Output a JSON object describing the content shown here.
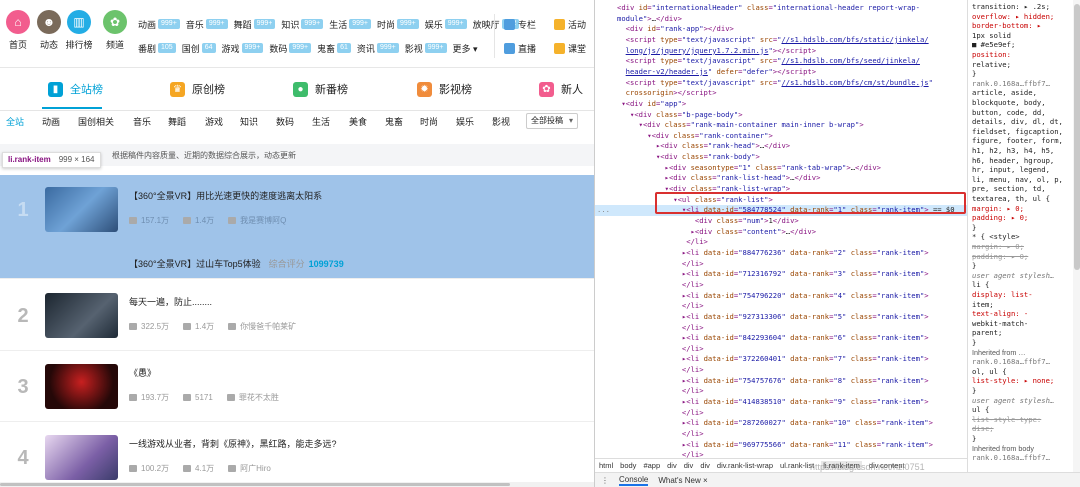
{
  "topnav": {
    "icons": [
      {
        "label": "首页",
        "color": "#f25d8e",
        "glyph": "⌂"
      },
      {
        "label": "动态",
        "color": "#7a6a5a",
        "glyph": "☻"
      },
      {
        "label": "排行榜",
        "color": "#23ade5",
        "glyph": "▥"
      },
      {
        "label": "频道",
        "color": "#6cc36c",
        "glyph": "✿"
      }
    ],
    "categories_row1": [
      {
        "label": "动画",
        "badge": "999+"
      },
      {
        "label": "音乐",
        "badge": "999+"
      },
      {
        "label": "舞蹈",
        "badge": "999+"
      },
      {
        "label": "知识",
        "badge": "999+"
      },
      {
        "label": "生活",
        "badge": "999+"
      },
      {
        "label": "时尚",
        "badge": "999+"
      },
      {
        "label": "娱乐",
        "badge": "999+"
      },
      {
        "label": "放映厅",
        "badge": "122"
      }
    ],
    "categories_row2": [
      {
        "label": "番剧",
        "badge": "105"
      },
      {
        "label": "国创",
        "badge": "64"
      },
      {
        "label": "游戏",
        "badge": "999+"
      },
      {
        "label": "数码",
        "badge": "999+"
      },
      {
        "label": "鬼畜",
        "badge": "61"
      },
      {
        "label": "资讯",
        "badge": "999+"
      },
      {
        "label": "影视",
        "badge": "999+"
      },
      {
        "label": "更多 ▾",
        "badge": ""
      }
    ],
    "right_links": [
      {
        "label": "专栏",
        "color": "#4f9dde"
      },
      {
        "label": "活动",
        "color": "#f5b22b"
      },
      {
        "label": "直播",
        "color": "#4f9dde"
      },
      {
        "label": "课堂",
        "color": "#f5b22b"
      }
    ]
  },
  "tabs": [
    {
      "label": "全站榜",
      "color": "#00a1d6",
      "glyph": "▮"
    },
    {
      "label": "原创榜",
      "color": "#f5a623",
      "glyph": "♛"
    },
    {
      "label": "新番榜",
      "color": "#3ebc6b",
      "glyph": "●"
    },
    {
      "label": "影视榜",
      "color": "#f08c3c",
      "glyph": "✹"
    },
    {
      "label": "新人",
      "color": "#f25d8e",
      "glyph": "✿"
    }
  ],
  "subnav": {
    "items": [
      "全站",
      "动画",
      "国创相关",
      "音乐",
      "舞蹈",
      "游戏",
      "知识",
      "数码",
      "生活",
      "美食",
      "鬼畜",
      "时尚",
      "娱乐",
      "影视"
    ],
    "select": "全部投稿"
  },
  "notice": "根据稿件内容质量、近期的数据综合展示，动态更新",
  "tooltip": {
    "tag": "li.rank-item",
    "size": "999 × 164"
  },
  "items": [
    {
      "rank": "1",
      "title": "【360°全景VR】用比光速更快的速度逃离太阳系",
      "plays": "157.1万",
      "comments": "1.4万",
      "author": "我是赛博阿Q",
      "sub_title": "【360°全景VR】过山车Top5体验",
      "score_label": "综合评分",
      "score": "1099739"
    },
    {
      "rank": "2",
      "title": "每天一遍，防止........",
      "plays": "322.5万",
      "comments": "1.4万",
      "author": "你慢爸千帕莱矿"
    },
    {
      "rank": "3",
      "title": "《愚》",
      "plays": "193.7万",
      "comments": "5171",
      "author": "罪花不太胜"
    },
    {
      "rank": "4",
      "title": "一线游戏从业者，背刺《原神》，黑红路，能走多远?",
      "plays": "100.2万",
      "comments": "4.1万",
      "author": "阿广Hiro"
    }
  ],
  "devtools": {
    "elements": [
      {
        "dots": "",
        "html": "<span class='t'>&lt;div</span> <span class='a'>id</span>=<span class='v'>\"internationalHeader\"</span> <span class='a'>class</span>=<span class='v'>\"international-header report-wrap-</span>"
      },
      {
        "dots": "",
        "html": "<span class='v'>module\"</span><span class='t'>&gt;</span><span class='tx'>…</span><span class='t'>&lt;/div&gt;</span>"
      },
      {
        "dots": "",
        "html": "&nbsp;&nbsp;<span class='t'>&lt;div</span> <span class='a'>id</span>=<span class='v'>\"rank-app\"</span><span class='t'>&gt;&lt;/div&gt;</span>"
      },
      {
        "dots": "",
        "html": "&nbsp;&nbsp;<span class='t'>&lt;script</span> <span class='a'>type</span>=<span class='v'>\"text/javascript\"</span> <span class='a'>src</span>=<span class='v'>\"</span><span class='u'>//s1.hdslb.com/bfs/static/jinkela/</span>"
      },
      {
        "dots": "",
        "html": "&nbsp;&nbsp;<span class='u'>long/js/jquery/jquery1.7.2.min.js</span><span class='v'>\"</span><span class='t'>&gt;&lt;/script&gt;</span>"
      },
      {
        "dots": "",
        "html": "&nbsp;&nbsp;<span class='t'>&lt;script</span> <span class='a'>type</span>=<span class='v'>\"text/javascript\"</span> <span class='a'>src</span>=<span class='v'>\"</span><span class='u'>//s1.hdslb.com/bfs/seed/jinkela/</span>"
      },
      {
        "dots": "",
        "html": "&nbsp;&nbsp;<span class='u'>header-v2/header.js</span><span class='v'>\"</span> <span class='a'>defer</span>=<span class='v'>\"defer\"</span><span class='t'>&gt;&lt;/script&gt;</span>"
      },
      {
        "dots": "",
        "html": "&nbsp;&nbsp;<span class='t'>&lt;script</span> <span class='a'>type</span>=<span class='v'>\"text/javascript\"</span> <span class='a'>src</span>=<span class='v'>\"</span><span class='u'>//s1.hdslb.com/bfs/cm/st/bundle.js</span><span class='v'>\"</span>"
      },
      {
        "dots": "",
        "html": "&nbsp;&nbsp;<span class='a'>crossorigin</span><span class='t'>&gt;&lt;/script&gt;</span>"
      },
      {
        "dots": "",
        "html": "&nbsp;▾<span class='t'>&lt;div</span> <span class='a'>id</span>=<span class='v'>\"app\"</span><span class='t'>&gt;</span>"
      },
      {
        "dots": "",
        "html": "&nbsp;&nbsp;&nbsp;▾<span class='t'>&lt;div</span> <span class='a'>class</span>=<span class='v'>\"b-page-body\"</span><span class='t'>&gt;</span>"
      },
      {
        "dots": "",
        "html": "&nbsp;&nbsp;&nbsp;&nbsp;&nbsp;▾<span class='t'>&lt;div</span> <span class='a'>class</span>=<span class='v'>\"rank-main-container main-inner b-wrap\"</span><span class='t'>&gt;</span>"
      },
      {
        "dots": "",
        "html": "&nbsp;&nbsp;&nbsp;&nbsp;&nbsp;&nbsp;&nbsp;▾<span class='t'>&lt;div</span> <span class='a'>class</span>=<span class='v'>\"rank-container\"</span><span class='t'>&gt;</span>"
      },
      {
        "dots": "",
        "html": "&nbsp;&nbsp;&nbsp;&nbsp;&nbsp;&nbsp;&nbsp;&nbsp;&nbsp;▸<span class='t'>&lt;div</span> <span class='a'>class</span>=<span class='v'>\"rank-head\"</span><span class='t'>&gt;</span><span class='tx'>…</span><span class='t'>&lt;/div&gt;</span>"
      },
      {
        "dots": "",
        "html": "&nbsp;&nbsp;&nbsp;&nbsp;&nbsp;&nbsp;&nbsp;&nbsp;&nbsp;▾<span class='t'>&lt;div</span> <span class='a'>class</span>=<span class='v'>\"rank-body\"</span><span class='t'>&gt;</span>"
      },
      {
        "dots": "",
        "html": "&nbsp;&nbsp;&nbsp;&nbsp;&nbsp;&nbsp;&nbsp;&nbsp;&nbsp;&nbsp;&nbsp;▸<span class='t'>&lt;div</span> <span class='a'>seasontype</span>=<span class='v'>\"1\"</span> <span class='a'>class</span>=<span class='v'>\"rank-tab-wrap\"</span><span class='t'>&gt;</span><span class='tx'>…</span><span class='t'>&lt;/div&gt;</span>"
      },
      {
        "dots": "",
        "html": "&nbsp;&nbsp;&nbsp;&nbsp;&nbsp;&nbsp;&nbsp;&nbsp;&nbsp;&nbsp;&nbsp;▸<span class='t'>&lt;div</span> <span class='a'>class</span>=<span class='v'>\"rank-list-head\"</span><span class='t'>&gt;</span><span class='tx'>…</span><span class='t'>&lt;/div&gt;</span>"
      },
      {
        "dots": "",
        "html": "&nbsp;&nbsp;&nbsp;&nbsp;&nbsp;&nbsp;&nbsp;&nbsp;&nbsp;&nbsp;&nbsp;▾<span class='t'>&lt;div</span> <span class='a'>class</span>=<span class='v'>\"rank-list-wrap\"</span><span class='t'>&gt;</span>"
      },
      {
        "dots": "",
        "html": "&nbsp;&nbsp;&nbsp;&nbsp;&nbsp;&nbsp;&nbsp;&nbsp;&nbsp;&nbsp;&nbsp;&nbsp;&nbsp;▾<span class='t'>&lt;ul</span> <span class='a'>class</span>=<span class='v'>\"rank-list\"</span><span class='t'>&gt;</span>"
      },
      {
        "dots": "...",
        "sel": true,
        "html": "&nbsp;&nbsp;&nbsp;&nbsp;&nbsp;&nbsp;&nbsp;&nbsp;&nbsp;&nbsp;&nbsp;&nbsp;&nbsp;&nbsp;&nbsp;▾<span class='t'>&lt;li</span> <span class='a'>data-id</span>=<span class='v'>\"584778524\"</span> <span class='a'>data-rank</span>=<span class='v'>\"1\"</span> <span class='a'>class</span>=<span class='v'>\"rank-item\"</span><span class='t'>&gt;</span> <span class='tx'>== $0</span>"
      },
      {
        "dots": "",
        "html": "&nbsp;&nbsp;&nbsp;&nbsp;&nbsp;&nbsp;&nbsp;&nbsp;&nbsp;&nbsp;&nbsp;&nbsp;&nbsp;&nbsp;&nbsp;&nbsp;&nbsp;&nbsp;<span class='t'>&lt;div</span> <span class='a'>class</span>=<span class='v'>\"num\"</span><span class='t'>&gt;</span><span class='tx'>1</span><span class='t'>&lt;/div&gt;</span>"
      },
      {
        "dots": "",
        "html": "&nbsp;&nbsp;&nbsp;&nbsp;&nbsp;&nbsp;&nbsp;&nbsp;&nbsp;&nbsp;&nbsp;&nbsp;&nbsp;&nbsp;&nbsp;&nbsp;&nbsp;▸<span class='t'>&lt;div</span> <span class='a'>class</span>=<span class='v'>\"content\"</span><span class='t'>&gt;</span><span class='tx'>…</span><span class='t'>&lt;/div&gt;</span>"
      },
      {
        "dots": "",
        "html": "&nbsp;&nbsp;&nbsp;&nbsp;&nbsp;&nbsp;&nbsp;&nbsp;&nbsp;&nbsp;&nbsp;&nbsp;&nbsp;&nbsp;&nbsp;&nbsp;<span class='t'>&lt;/li&gt;</span>"
      },
      {
        "dots": "",
        "html": "&nbsp;&nbsp;&nbsp;&nbsp;&nbsp;&nbsp;&nbsp;&nbsp;&nbsp;&nbsp;&nbsp;&nbsp;&nbsp;&nbsp;&nbsp;▸<span class='t'>&lt;li</span> <span class='a'>data-id</span>=<span class='v'>\"884776236\"</span> <span class='a'>data-rank</span>=<span class='v'>\"2\"</span> <span class='a'>class</span>=<span class='v'>\"rank-item\"</span><span class='t'>&gt;</span>"
      },
      {
        "dots": "",
        "html": "&nbsp;&nbsp;&nbsp;&nbsp;&nbsp;&nbsp;&nbsp;&nbsp;&nbsp;&nbsp;&nbsp;&nbsp;&nbsp;&nbsp;&nbsp;<span class='t'>&lt;/li&gt;</span>"
      },
      {
        "dots": "",
        "html": "&nbsp;&nbsp;&nbsp;&nbsp;&nbsp;&nbsp;&nbsp;&nbsp;&nbsp;&nbsp;&nbsp;&nbsp;&nbsp;&nbsp;&nbsp;▸<span class='t'>&lt;li</span> <span class='a'>data-id</span>=<span class='v'>\"712316792\"</span> <span class='a'>data-rank</span>=<span class='v'>\"3\"</span> <span class='a'>class</span>=<span class='v'>\"rank-item\"</span><span class='t'>&gt;</span>"
      },
      {
        "dots": "",
        "html": "&nbsp;&nbsp;&nbsp;&nbsp;&nbsp;&nbsp;&nbsp;&nbsp;&nbsp;&nbsp;&nbsp;&nbsp;&nbsp;&nbsp;&nbsp;<span class='t'>&lt;/li&gt;</span>"
      },
      {
        "dots": "",
        "html": "&nbsp;&nbsp;&nbsp;&nbsp;&nbsp;&nbsp;&nbsp;&nbsp;&nbsp;&nbsp;&nbsp;&nbsp;&nbsp;&nbsp;&nbsp;▸<span class='t'>&lt;li</span> <span class='a'>data-id</span>=<span class='v'>\"754796220\"</span> <span class='a'>data-rank</span>=<span class='v'>\"4\"</span> <span class='a'>class</span>=<span class='v'>\"rank-item\"</span><span class='t'>&gt;</span>"
      },
      {
        "dots": "",
        "html": "&nbsp;&nbsp;&nbsp;&nbsp;&nbsp;&nbsp;&nbsp;&nbsp;&nbsp;&nbsp;&nbsp;&nbsp;&nbsp;&nbsp;&nbsp;<span class='t'>&lt;/li&gt;</span>"
      },
      {
        "dots": "",
        "html": "&nbsp;&nbsp;&nbsp;&nbsp;&nbsp;&nbsp;&nbsp;&nbsp;&nbsp;&nbsp;&nbsp;&nbsp;&nbsp;&nbsp;&nbsp;▸<span class='t'>&lt;li</span> <span class='a'>data-id</span>=<span class='v'>\"927313306\"</span> <span class='a'>data-rank</span>=<span class='v'>\"5\"</span> <span class='a'>class</span>=<span class='v'>\"rank-item\"</span><span class='t'>&gt;</span>"
      },
      {
        "dots": "",
        "html": "&nbsp;&nbsp;&nbsp;&nbsp;&nbsp;&nbsp;&nbsp;&nbsp;&nbsp;&nbsp;&nbsp;&nbsp;&nbsp;&nbsp;&nbsp;<span class='t'>&lt;/li&gt;</span>"
      },
      {
        "dots": "",
        "html": "&nbsp;&nbsp;&nbsp;&nbsp;&nbsp;&nbsp;&nbsp;&nbsp;&nbsp;&nbsp;&nbsp;&nbsp;&nbsp;&nbsp;&nbsp;▸<span class='t'>&lt;li</span> <span class='a'>data-id</span>=<span class='v'>\"842293604\"</span> <span class='a'>data-rank</span>=<span class='v'>\"6\"</span> <span class='a'>class</span>=<span class='v'>\"rank-item\"</span><span class='t'>&gt;</span>"
      },
      {
        "dots": "",
        "html": "&nbsp;&nbsp;&nbsp;&nbsp;&nbsp;&nbsp;&nbsp;&nbsp;&nbsp;&nbsp;&nbsp;&nbsp;&nbsp;&nbsp;&nbsp;<span class='t'>&lt;/li&gt;</span>"
      },
      {
        "dots": "",
        "html": "&nbsp;&nbsp;&nbsp;&nbsp;&nbsp;&nbsp;&nbsp;&nbsp;&nbsp;&nbsp;&nbsp;&nbsp;&nbsp;&nbsp;&nbsp;▸<span class='t'>&lt;li</span> <span class='a'>data-id</span>=<span class='v'>\"372260401\"</span> <span class='a'>data-rank</span>=<span class='v'>\"7\"</span> <span class='a'>class</span>=<span class='v'>\"rank-item\"</span><span class='t'>&gt;</span>"
      },
      {
        "dots": "",
        "html": "&nbsp;&nbsp;&nbsp;&nbsp;&nbsp;&nbsp;&nbsp;&nbsp;&nbsp;&nbsp;&nbsp;&nbsp;&nbsp;&nbsp;&nbsp;<span class='t'>&lt;/li&gt;</span>"
      },
      {
        "dots": "",
        "html": "&nbsp;&nbsp;&nbsp;&nbsp;&nbsp;&nbsp;&nbsp;&nbsp;&nbsp;&nbsp;&nbsp;&nbsp;&nbsp;&nbsp;&nbsp;▸<span class='t'>&lt;li</span> <span class='a'>data-id</span>=<span class='v'>\"754757676\"</span> <span class='a'>data-rank</span>=<span class='v'>\"8\"</span> <span class='a'>class</span>=<span class='v'>\"rank-item\"</span><span class='t'>&gt;</span>"
      },
      {
        "dots": "",
        "html": "&nbsp;&nbsp;&nbsp;&nbsp;&nbsp;&nbsp;&nbsp;&nbsp;&nbsp;&nbsp;&nbsp;&nbsp;&nbsp;&nbsp;&nbsp;<span class='t'>&lt;/li&gt;</span>"
      },
      {
        "dots": "",
        "html": "&nbsp;&nbsp;&nbsp;&nbsp;&nbsp;&nbsp;&nbsp;&nbsp;&nbsp;&nbsp;&nbsp;&nbsp;&nbsp;&nbsp;&nbsp;▸<span class='t'>&lt;li</span> <span class='a'>data-id</span>=<span class='v'>\"414838510\"</span> <span class='a'>data-rank</span>=<span class='v'>\"9\"</span> <span class='a'>class</span>=<span class='v'>\"rank-item\"</span><span class='t'>&gt;</span>"
      },
      {
        "dots": "",
        "html": "&nbsp;&nbsp;&nbsp;&nbsp;&nbsp;&nbsp;&nbsp;&nbsp;&nbsp;&nbsp;&nbsp;&nbsp;&nbsp;&nbsp;&nbsp;<span class='t'>&lt;/li&gt;</span>"
      },
      {
        "dots": "",
        "html": "&nbsp;&nbsp;&nbsp;&nbsp;&nbsp;&nbsp;&nbsp;&nbsp;&nbsp;&nbsp;&nbsp;&nbsp;&nbsp;&nbsp;&nbsp;▸<span class='t'>&lt;li</span> <span class='a'>data-id</span>=<span class='v'>\"287260027\"</span> <span class='a'>data-rank</span>=<span class='v'>\"10\"</span> <span class='a'>class</span>=<span class='v'>\"rank-item\"</span><span class='t'>&gt;</span>"
      },
      {
        "dots": "",
        "html": "&nbsp;&nbsp;&nbsp;&nbsp;&nbsp;&nbsp;&nbsp;&nbsp;&nbsp;&nbsp;&nbsp;&nbsp;&nbsp;&nbsp;&nbsp;<span class='t'>&lt;/li&gt;</span>"
      },
      {
        "dots": "",
        "html": "&nbsp;&nbsp;&nbsp;&nbsp;&nbsp;&nbsp;&nbsp;&nbsp;&nbsp;&nbsp;&nbsp;&nbsp;&nbsp;&nbsp;&nbsp;▸<span class='t'>&lt;li</span> <span class='a'>data-id</span>=<span class='v'>\"969775566\"</span> <span class='a'>data-rank</span>=<span class='v'>\"11\"</span> <span class='a'>class</span>=<span class='v'>\"rank-item\"</span><span class='t'>&gt;</span>"
      },
      {
        "dots": "",
        "html": "&nbsp;&nbsp;&nbsp;&nbsp;&nbsp;&nbsp;&nbsp;&nbsp;&nbsp;&nbsp;&nbsp;&nbsp;&nbsp;&nbsp;&nbsp;<span class='t'>&lt;/li&gt;</span>"
      }
    ],
    "breadcrumbs": [
      "html",
      "body",
      "#app",
      "div",
      "div",
      "div",
      "div.rank-list-wrap",
      "ul.rank-list",
      "li.rank-item",
      "div.content"
    ],
    "breadcrumb_current": "li.rank-item",
    "drawer": [
      "Console",
      "What's New ×"
    ],
    "styles": [
      {
        "cls": "val",
        "text": "transition: ▸ .2s;"
      },
      {
        "cls": "prop",
        "text": "overflow: ▸ hidden;"
      },
      {
        "cls": "prop",
        "text": "border-bottom: ▸"
      },
      {
        "cls": "val",
        "text": "    1px solid"
      },
      {
        "cls": "val",
        "text": "    ■ #e5e9ef;"
      },
      {
        "cls": "prop",
        "text": "position:"
      },
      {
        "cls": "val",
        "text": "    relative;"
      },
      {
        "cls": "sel",
        "text": "}"
      },
      {
        "cls": "src",
        "text": "  rank.0.168a…ffbf7…"
      },
      {
        "cls": "sel",
        "text": "article, aside,"
      },
      {
        "cls": "sel",
        "text": "blockquote, body,"
      },
      {
        "cls": "sel",
        "text": "button, code, dd,"
      },
      {
        "cls": "sel",
        "text": "details, div, dl, dt,"
      },
      {
        "cls": "sel",
        "text": "fieldset, figcaption,"
      },
      {
        "cls": "sel",
        "text": "figure, footer, form,"
      },
      {
        "cls": "sel",
        "text": "h1, h2, h3, h4, h5,"
      },
      {
        "cls": "sel",
        "text": "h6, header, hgroup,"
      },
      {
        "cls": "sel",
        "text": "hr, input, legend,"
      },
      {
        "cls": "sel",
        "text": "li, menu, nav, ol, p,"
      },
      {
        "cls": "sel",
        "text": "pre, section, td,"
      },
      {
        "cls": "sel",
        "text": "textarea, th, ul {"
      },
      {
        "cls": "prop",
        "text": "  margin: ▸ 0;"
      },
      {
        "cls": "prop",
        "text": "  padding: ▸ 0;"
      },
      {
        "cls": "sel",
        "text": "}"
      },
      {
        "cls": "sel",
        "text": "* {          <style>"
      },
      {
        "cls": "strike",
        "text": "  margin: ▸ 0;"
      },
      {
        "cls": "strike",
        "text": "  padding: ▸ 0;"
      },
      {
        "cls": "sel",
        "text": "}"
      },
      {
        "cls": "italic",
        "text": "  user agent stylesh…"
      },
      {
        "cls": "sel",
        "text": "li {"
      },
      {
        "cls": "prop",
        "text": "  display: list-"
      },
      {
        "cls": "val",
        "text": "      item;"
      },
      {
        "cls": "prop",
        "text": "  text-align: -"
      },
      {
        "cls": "val",
        "text": "      webkit-match-"
      },
      {
        "cls": "val",
        "text": "      parent;"
      },
      {
        "cls": "sel",
        "text": "}"
      },
      {
        "cls": "hdr",
        "text": "Inherited from …"
      },
      {
        "cls": "src",
        "text": "  rank.0.168a…ffbf7…"
      },
      {
        "cls": "sel",
        "text": "ol, ul {"
      },
      {
        "cls": "prop",
        "text": "  list-style: ▸ none;"
      },
      {
        "cls": "sel",
        "text": "}"
      },
      {
        "cls": "italic",
        "text": "  user agent stylesh…"
      },
      {
        "cls": "sel",
        "text": "ul {"
      },
      {
        "cls": "strike",
        "text": "  list-style-type:"
      },
      {
        "cls": "strike",
        "text": "      disc;"
      },
      {
        "cls": "sel",
        "text": "}"
      },
      {
        "cls": "hdr",
        "text": "Inherited from body"
      },
      {
        "cls": "src",
        "text": "  rank.0.168a…ffbf7…"
      }
    ]
  },
  "watermark": "https://blog.csdn.net/nzl0751"
}
